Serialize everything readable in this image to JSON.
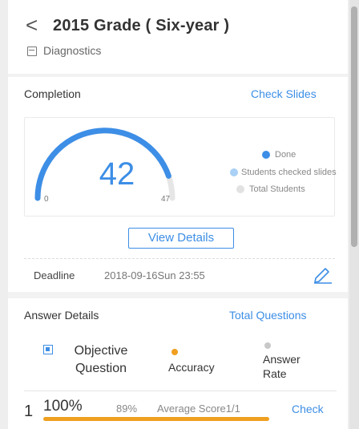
{
  "header": {
    "back_glyph": "<",
    "title": "2015 Grade ( Six-year )",
    "subtitle_icon": "document-icon",
    "subtitle": "Diagnostics"
  },
  "completion": {
    "section_title": "Completion",
    "link_label": "Check Slides",
    "gauge": {
      "done": 42,
      "min_label": "0",
      "max_label": "47",
      "total": 47
    },
    "legend": [
      {
        "label": "Done",
        "color": "#3d8ee6"
      },
      {
        "label": "Students checked slides",
        "color": "#a9d0f5"
      },
      {
        "label": "Total Students",
        "color": "#e2e2e2"
      }
    ],
    "view_details_label": "View Details",
    "deadline_label": "Deadline",
    "deadline_value": "2018-09-16Sun 23:55",
    "edit_icon": "pencil-icon"
  },
  "answers": {
    "section_title": "Answer Details",
    "link_label": "Total Questions",
    "objective_label": "Objective Question",
    "objective_icon": "checkbox-icon",
    "accuracy_label": "Accuracy",
    "accuracy_color": "#f0a020",
    "answer_rate_label": "Answer Rate",
    "answer_rate_color": "#c8c8c8",
    "rows": [
      {
        "number": "1",
        "accuracy": "100%",
        "answer_rate": "89%",
        "score": "Average Score1/1",
        "check_label": "Check",
        "accuracy_fraction": 1.0
      }
    ]
  },
  "colors": {
    "accent": "#3d8ee6",
    "orange": "#f0a020"
  }
}
